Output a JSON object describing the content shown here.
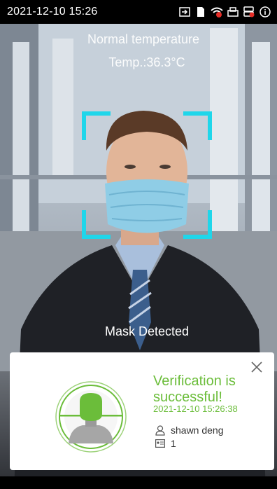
{
  "status_bar": {
    "datetime": "2021-12-10 15:26",
    "icons": [
      "exit-icon",
      "sim-card-icon",
      "wifi-alert-icon",
      "printer-icon",
      "database-alert-icon",
      "info-icon"
    ]
  },
  "overlay": {
    "temperature_status": "Normal temperature",
    "temperature_value": "Temp.:36.3°C",
    "mask_status": "Mask Detected",
    "frame_color": "#1fd6ea"
  },
  "result_card": {
    "title": "Verification is successful!",
    "timestamp": "2021-12-10 15:26:38",
    "user_name": "shawn deng",
    "user_id": "1",
    "accent_color": "#6bbd3a"
  }
}
